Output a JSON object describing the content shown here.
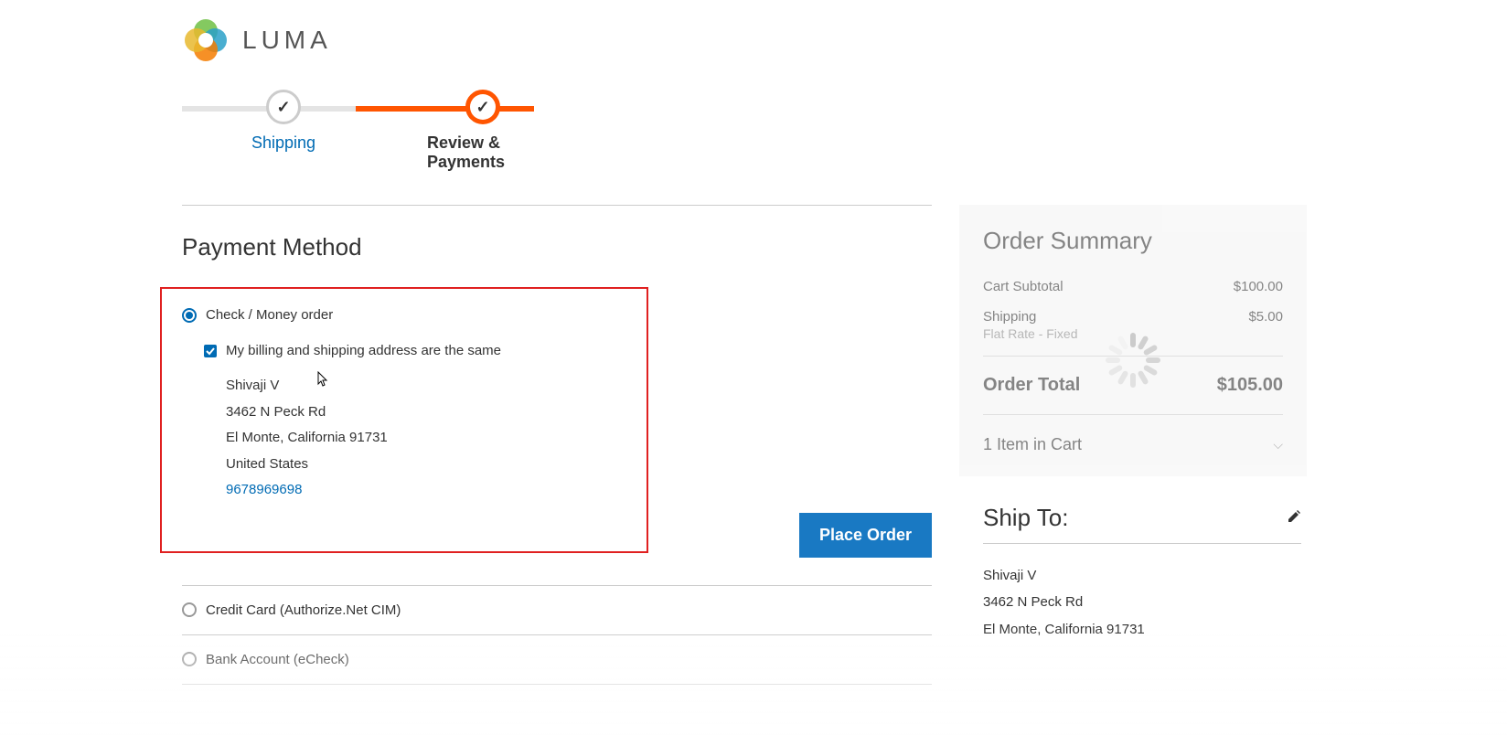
{
  "brand": "LUMA",
  "steps": {
    "shipping": "Shipping",
    "review": "Review & Payments"
  },
  "payment": {
    "title": "Payment Method",
    "options": {
      "check_money": "Check / Money order",
      "credit_card": "Credit Card (Authorize.Net CIM)",
      "bank_echeck": "Bank Account (eCheck)"
    },
    "billing_same_label": "My billing and shipping address are the same",
    "address": {
      "name": "Shivaji V",
      "street": "3462 N Peck Rd",
      "city_state_zip": "El Monte, California 91731",
      "country": "United States",
      "phone": "9678969698"
    },
    "place_order_label": "Place Order"
  },
  "summary": {
    "title": "Order Summary",
    "subtotal_label": "Cart Subtotal",
    "subtotal_value": "$100.00",
    "shipping_label": "Shipping",
    "shipping_value": "$5.00",
    "shipping_method": "Flat Rate - Fixed",
    "total_label": "Order Total",
    "total_value": "$105.00",
    "items_toggle": "1 Item in Cart"
  },
  "ship_to": {
    "title": "Ship To:",
    "name": "Shivaji V",
    "street": "3462 N Peck Rd",
    "city_state_zip": "El Monte, California 91731"
  }
}
